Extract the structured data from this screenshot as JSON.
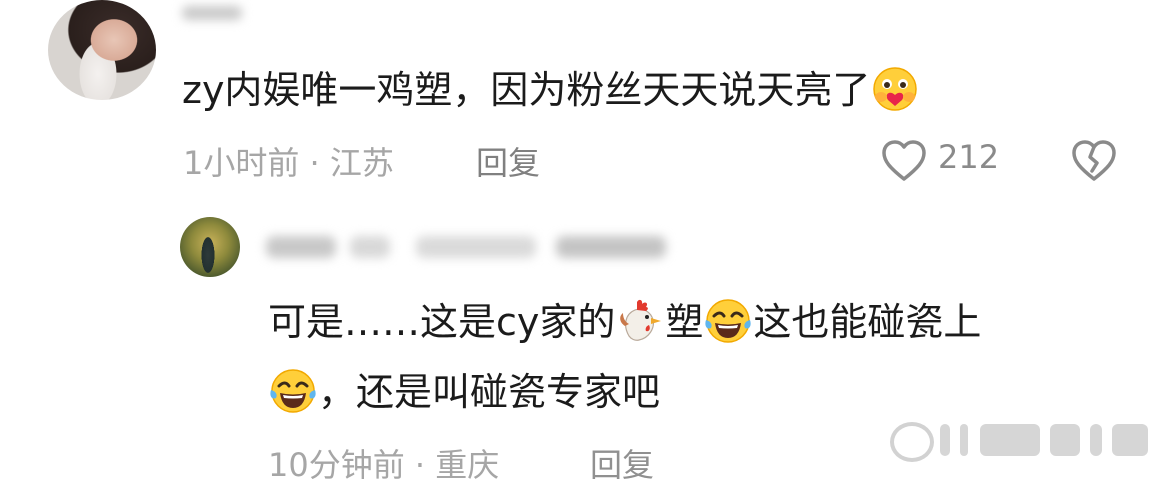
{
  "comments": [
    {
      "text": "zy内娱唯一鸡塑，因为粉丝天天说天亮了",
      "emoji": "hugging-heart-face",
      "time_location": "1小时前 · 江苏",
      "reply_label": "回复",
      "likes": "212"
    },
    {
      "line1_a": "可是……这是cy家的",
      "line1_emoji1": "rooster",
      "line1_b": "塑",
      "line1_emoji2": "laughing-tears-face",
      "line1_c": "这也能碰瓷上",
      "line2_emoji": "laughing-tears-face",
      "line2_text": "，还是叫碰瓷专家吧",
      "time_location": "10分钟前 · 重庆",
      "reply_label": "回复"
    }
  ],
  "icons": {
    "like": "heart-outline-icon",
    "dislike": "broken-heart-icon"
  },
  "colors": {
    "text": "#1b1b1b",
    "meta": "#a6a6a6",
    "icon": "#8a8a8a"
  }
}
